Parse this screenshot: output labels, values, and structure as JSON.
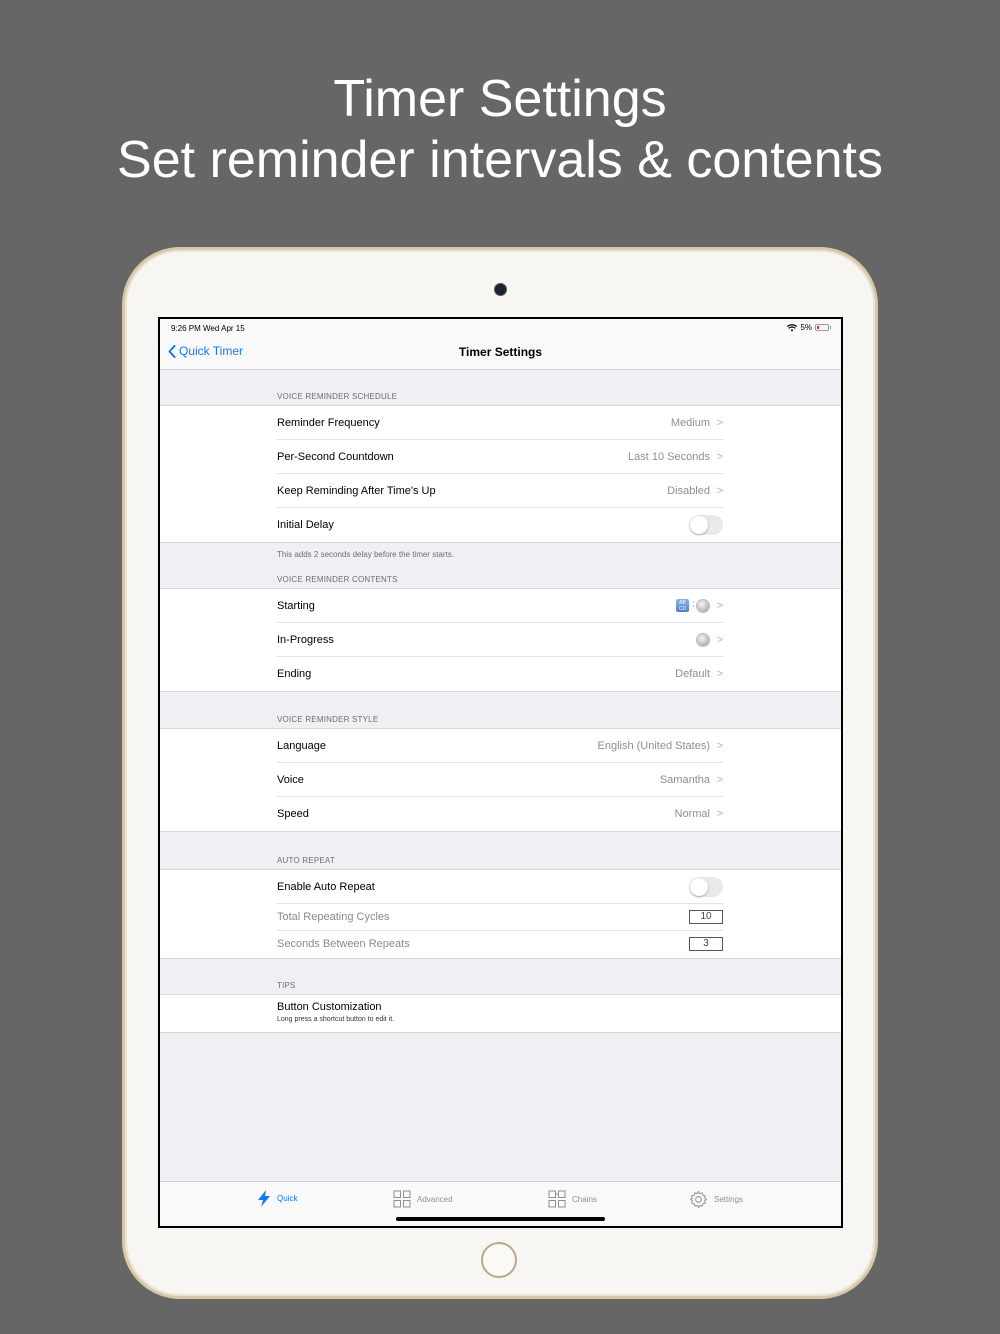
{
  "banner": {
    "line1": "Timer Settings",
    "line2": "Set reminder intervals & contents"
  },
  "status_bar": {
    "time": "9:26 PM   Wed Apr 15",
    "battery": "5%"
  },
  "nav": {
    "back_label": "Quick Timer",
    "title": "Timer Settings"
  },
  "sections": {
    "schedule": {
      "header": "VOICE REMINDER SCHEDULE",
      "rows": [
        {
          "label": "Reminder Frequency",
          "value": "Medium"
        },
        {
          "label": "Per-Second Countdown",
          "value": "Last 10 Seconds"
        },
        {
          "label": "Keep Reminding After Time's Up",
          "value": "Disabled"
        },
        {
          "label": "Initial Delay",
          "toggle": false
        }
      ],
      "footer": "This adds 2 seconds delay before the timer starts."
    },
    "contents": {
      "header": "VOICE REMINDER CONTENTS",
      "rows": [
        {
          "label": "Starting",
          "icons": [
            "abc-icon",
            "timer-icon"
          ]
        },
        {
          "label": "In-Progress",
          "icons": [
            "timer-icon"
          ]
        },
        {
          "label": "Ending",
          "value": "Default"
        }
      ]
    },
    "style": {
      "header": "VOICE REMINDER STYLE",
      "rows": [
        {
          "label": "Language",
          "value": "English (United States)"
        },
        {
          "label": "Voice",
          "value": "Samantha"
        },
        {
          "label": "Speed",
          "value": "Normal"
        }
      ]
    },
    "auto_repeat": {
      "header": "AUTO REPEAT",
      "rows": [
        {
          "label": "Enable Auto Repeat",
          "toggle": false
        },
        {
          "label": "Total Repeating Cycles",
          "value": "10"
        },
        {
          "label": "Seconds Between Repeats",
          "value": "3"
        }
      ]
    },
    "tips": {
      "header": "TIPS",
      "title": "Button Customization",
      "subtitle": "Long press a shortcut button to edit it."
    }
  },
  "tabbar": {
    "items": [
      {
        "label": "Quick",
        "icon": "bolt-icon",
        "active": true
      },
      {
        "label": "Advanced",
        "icon": "grid-icon",
        "active": false
      },
      {
        "label": "Chains",
        "icon": "grid-chain-icon",
        "active": false
      },
      {
        "label": "Settings",
        "icon": "gear-icon",
        "active": false
      }
    ]
  },
  "colors": {
    "background": "#666666",
    "accent": "#1476f5",
    "grouped_bg": "#efeff4"
  }
}
